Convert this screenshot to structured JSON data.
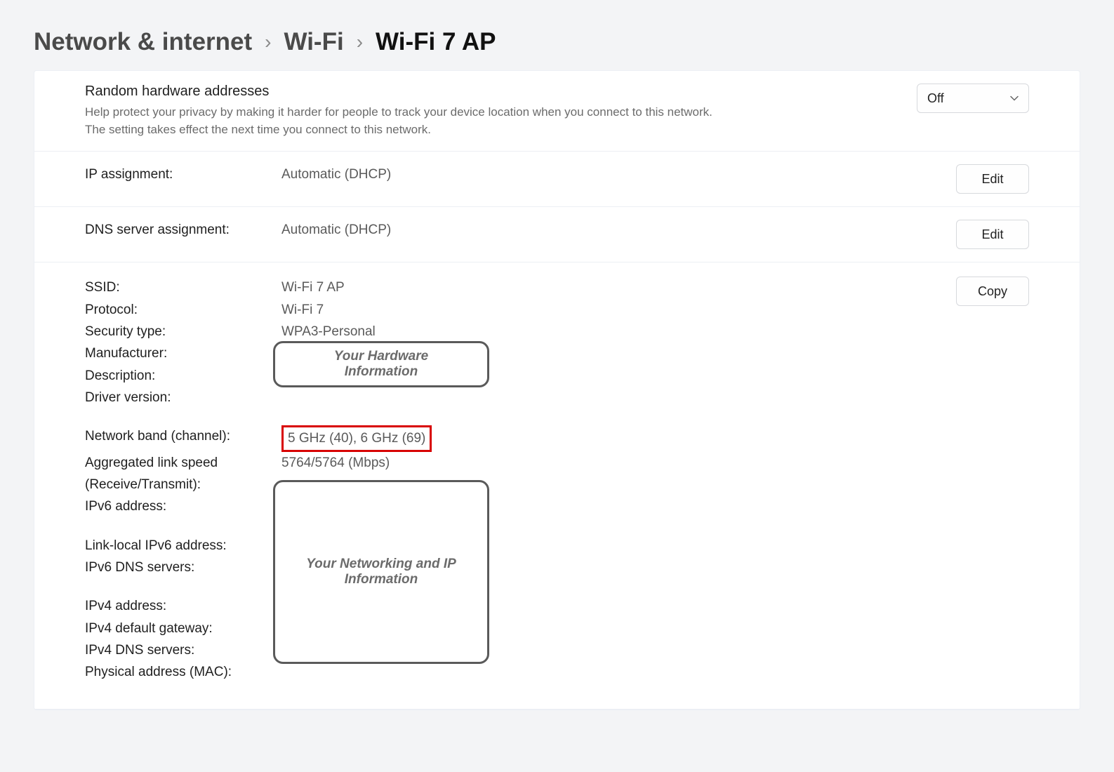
{
  "breadcrumb": {
    "items": [
      "Network & internet",
      "Wi-Fi"
    ],
    "current": "Wi-Fi 7 AP"
  },
  "random_hw": {
    "title": "Random hardware addresses",
    "desc": "Help protect your privacy by making it harder for people to track your device location when you connect to this network. The setting takes effect the next time you connect to this network.",
    "dropdown_value": "Off"
  },
  "ip_assignment": {
    "label": "IP assignment:",
    "value": "Automatic (DHCP)",
    "button": "Edit"
  },
  "dns_assignment": {
    "label": "DNS server assignment:",
    "value": "Automatic (DHCP)",
    "button": "Edit"
  },
  "props": {
    "copy_button": "Copy",
    "ssid": {
      "label": "SSID:",
      "value": "Wi-Fi 7 AP"
    },
    "protocol": {
      "label": "Protocol:",
      "value": "Wi-Fi 7"
    },
    "security": {
      "label": "Security type:",
      "value": "WPA3-Personal"
    },
    "manufacturer": {
      "label": "Manufacturer:",
      "value": ""
    },
    "description": {
      "label": "Description:",
      "value": ""
    },
    "driver": {
      "label": "Driver version:",
      "value": ""
    },
    "hw_placeholder": "Your Hardware Information",
    "band": {
      "label": "Network band (channel):",
      "value": "5 GHz (40), 6 GHz (69)"
    },
    "link_speed": {
      "label": "Aggregated link speed (Receive/Transmit):",
      "value": "5764/5764 (Mbps)"
    },
    "ipv6": {
      "label": "IPv6 address:",
      "value": ""
    },
    "linklocal6": {
      "label": "Link-local IPv6 address:",
      "value": ""
    },
    "ipv6dns": {
      "label": "IPv6 DNS servers:",
      "value": ""
    },
    "ipv4": {
      "label": "IPv4 address:",
      "value": ""
    },
    "ipv4gw": {
      "label": "IPv4 default gateway:",
      "value": ""
    },
    "ipv4dns": {
      "label": "IPv4 DNS servers:",
      "value": ""
    },
    "mac": {
      "label": "Physical address (MAC):",
      "value": ""
    },
    "net_placeholder": "Your Networking and IP Information"
  }
}
